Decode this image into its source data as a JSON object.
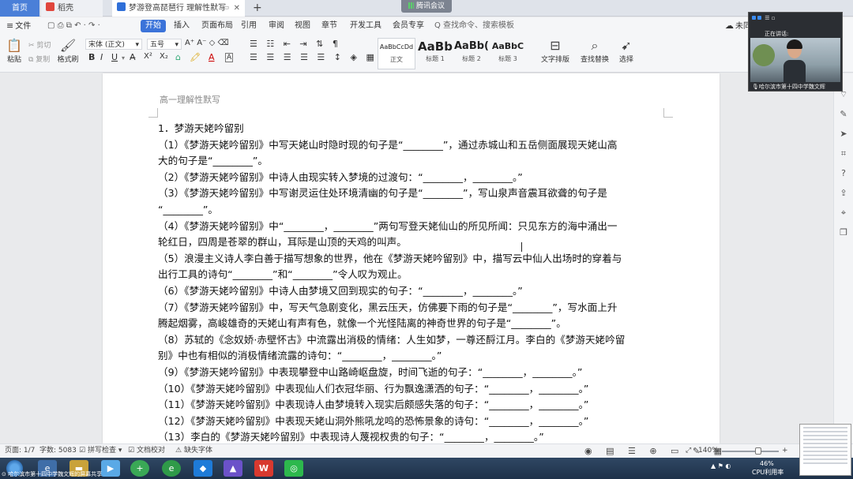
{
  "tabs": {
    "home": "首页",
    "daoke": "稻壳",
    "doc": "梦游登高琵琶行 理解性默写",
    "add": "+"
  },
  "meeting_badge": "腾讯会议",
  "menu": {
    "file": "文件",
    "start": "开始",
    "insert": "插入",
    "layout": "页面布局",
    "ref": "引用",
    "review": "审阅",
    "view": "视图",
    "chapter": "章节",
    "dev": "开发工具",
    "member": "会员专享",
    "search": "Q 查找命令、搜索模板",
    "cloud": "未同"
  },
  "toolbar": {
    "paste": "粘贴",
    "cut": "剪切",
    "copy": "复制",
    "format_painter": "格式刷",
    "font_name": "宋体 (正文)",
    "font_size": "五号",
    "styles": [
      {
        "sample": "AaBbCcDd",
        "caption": "正文"
      },
      {
        "sample": "AaBb",
        "caption": "标题 1"
      },
      {
        "sample": "AaBb(",
        "caption": "标题 2"
      },
      {
        "sample": "AaBbC",
        "caption": "标题 3"
      }
    ],
    "text_layout": "文字排版",
    "find_replace": "查找替换",
    "select": "选择"
  },
  "document": {
    "header": "高一理解性默写",
    "lines": [
      "1．梦游天姥吟留别",
      "（1）《梦游天姥吟留别》中写天姥山时隐时现的句子是“________”，通过赤城山和五岳侧面展现天姥山高",
      "大的句子是“________”。",
      "（2）《梦游天姥吟留别》中诗人由现实转入梦境的过渡句：“________，________。”",
      "（3）《梦游天姥吟留别》中写谢灵运住处环境清幽的句子是“________”，写山泉声音震耳欲聋的句子是",
      "“________”。",
      "（4）《梦游天姥吟留别》中“________，________”两句写登天姥仙山的所见所闻：只见东方的海中涌出一",
      "轮红日，四周是苍翠的群山，耳际是山顶的天鸡的叫声。",
      "（5）浪漫主义诗人李白善于描写想象的世界，他在《梦游天姥吟留别》中，描写云中仙人出场时的穿着与",
      "出行工具的诗句“________”和“________”令人叹为观止。",
      "（6）《梦游天姥吟留别》中诗人由梦境又回到现实的句子：“________，________。”",
      "（7）《梦游天姥吟留别》中，写天气急剧变化，黑云压天，仿佛要下雨的句子是“________”，写水面上升",
      "腾起烟雾，高峻雄奇的天姥山有声有色，就像一个光怪陆离的神奇世界的句子是“________”。",
      "（8）苏轼的《念奴娇·赤壁怀古》中流露出消极的情绪：人生如梦，一尊还酹江月。李白的《梦游天姥吟留",
      "别》中也有相似的消极情绪流露的诗句：“________，________。”",
      "（9）《梦游天姥吟留别》中表现攀登中山路崎岖盘旋，时间飞逝的句子：“________，________。”",
      "（10）《梦游天姥吟留别》中表现仙人们衣冠华丽、行为飘逸潇洒的句子：“________，________。”",
      "（11）《梦游天姥吟留别》中表现诗人由梦境转入现实后颇感失落的句子：“________，________。”",
      "（12）《梦游天姥吟留别》中表现天姥山洞外熊吼龙鸣的恐怖景象的诗句：“________，________。”",
      "（13）李白的《梦游天姥吟留别》中表现诗人蔑视权贵的句子：“________，________。”"
    ]
  },
  "video": {
    "speaking": "正在讲话:",
    "caption": "哈尔滨市第十四中学魏文辉"
  },
  "status": {
    "page": "页面: 1/7",
    "words": "字数: 5083",
    "spell": "拼写检查",
    "proof": "文档校对",
    "missing_font": "缺失字体",
    "zoom": "140%"
  },
  "taskbar": {
    "share_label": "哈尔滨市第十四中学魏文辉的屏幕共享",
    "cpu_percent": "46%",
    "cpu_label": "CPU利用率"
  }
}
